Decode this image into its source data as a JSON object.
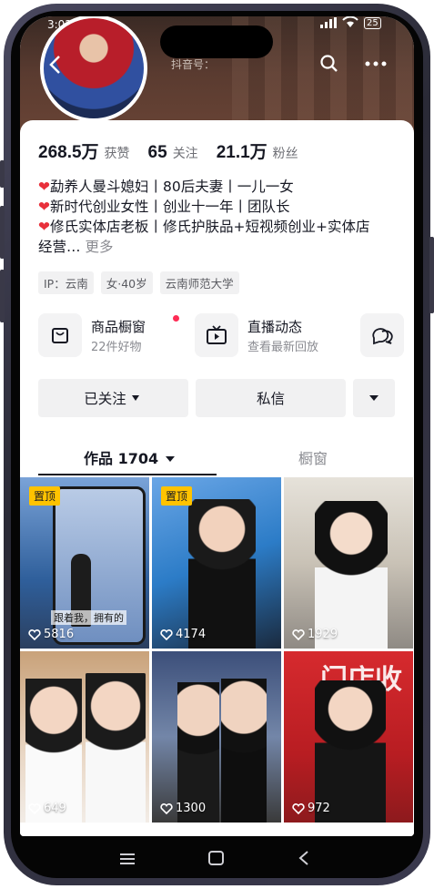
{
  "status": {
    "time": "3:02",
    "battery": "25"
  },
  "profile": {
    "douyin_id_label": "抖音号："
  },
  "stats": [
    {
      "num": "268.5万",
      "label": "获赞"
    },
    {
      "num": "65",
      "label": "关注"
    },
    {
      "num": "21.1万",
      "label": "粉丝"
    }
  ],
  "bio": {
    "line1": "勐养人曼斗媳妇丨80后夫妻丨一儿一女",
    "line2": "新时代创业女性丨创业十一年丨团队长",
    "line3": "修氏实体店老板丨修氏护肤品+短视频创业+实体店",
    "line4": "经营…",
    "more": "更多",
    "heart": "❤"
  },
  "tags": [
    "IP：云南",
    "女·40岁",
    "云南师范大学"
  ],
  "services": {
    "shop": {
      "title": "商品橱窗",
      "sub": "22件好物"
    },
    "live": {
      "title": "直播动态",
      "sub": "查看最新回放"
    }
  },
  "buttons": {
    "followed": "已关注",
    "message": "私信"
  },
  "tabs": {
    "works": "作品 1704",
    "showcase": "橱窗"
  },
  "videos": [
    {
      "pinned": true,
      "pin_label": "置顶",
      "likes": "5816",
      "overlay": "跟着我，拥有的"
    },
    {
      "pinned": true,
      "pin_label": "置顶",
      "likes": "4174"
    },
    {
      "pinned": false,
      "likes": "1929"
    },
    {
      "pinned": false,
      "likes": "649"
    },
    {
      "pinned": false,
      "likes": "1300"
    },
    {
      "pinned": false,
      "likes": "972",
      "overlay": "门店收"
    }
  ],
  "colors": {
    "accent_red": "#fe2c55",
    "pin_yellow": "#ffc300",
    "text": "#161823"
  }
}
